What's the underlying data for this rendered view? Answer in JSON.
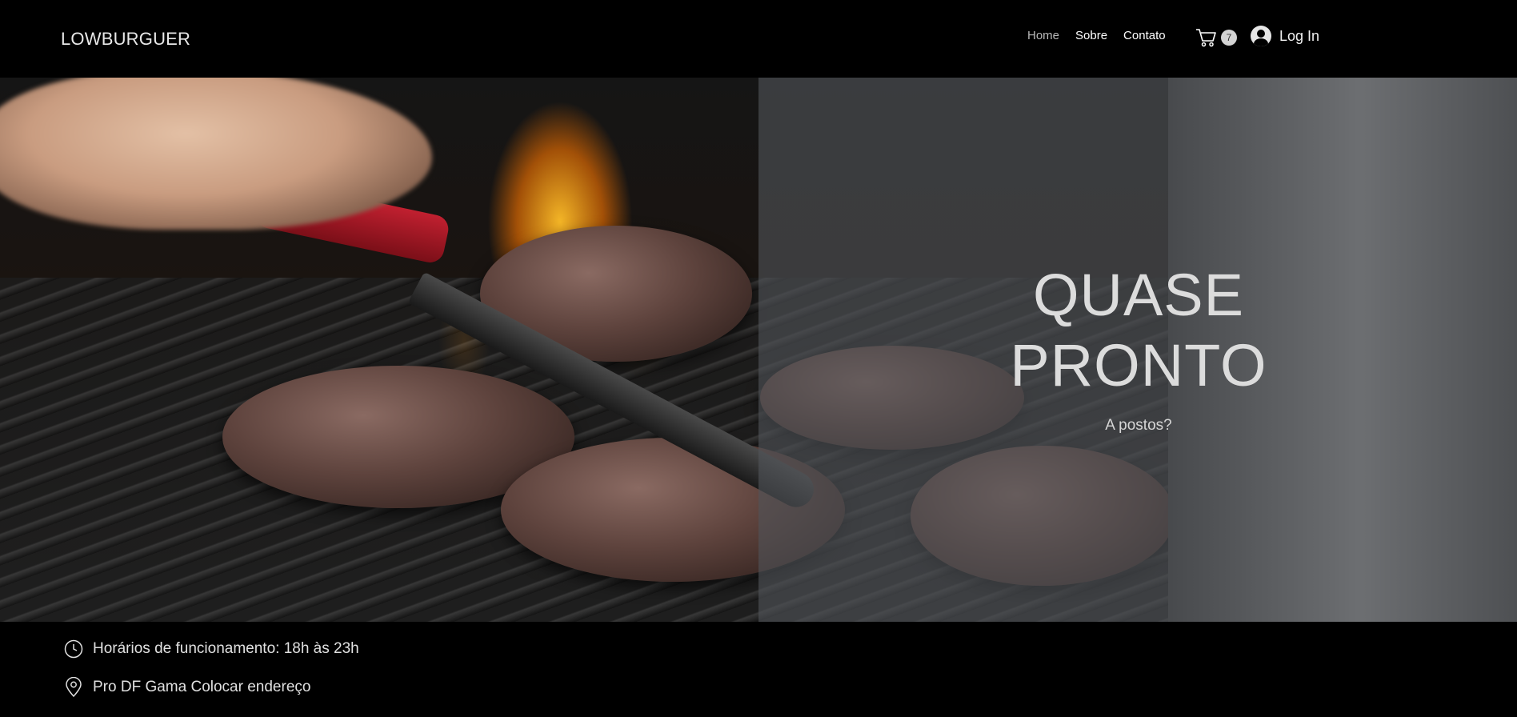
{
  "header": {
    "brand": "LOWBURGUER",
    "nav": [
      {
        "label": "Home",
        "active": true
      },
      {
        "label": "Sobre",
        "active": false
      },
      {
        "label": "Contato",
        "active": false
      }
    ],
    "cart_count": "7",
    "login_label": "Log In",
    "icons": {
      "cart": "cart-icon",
      "user": "user-avatar-icon"
    }
  },
  "hero": {
    "title_line1": "QUASE",
    "title_line2": "PRONTO",
    "subtitle": "A postos?"
  },
  "info": {
    "hours": "Horários de funcionamento: 18h às 23h",
    "address": "Pro DF Gama Colocar endereço",
    "icons": {
      "hours": "clock-icon",
      "address": "location-pin-icon"
    }
  },
  "colors": {
    "background": "#000000",
    "overlay": "#505458",
    "text": "#ffffff"
  }
}
